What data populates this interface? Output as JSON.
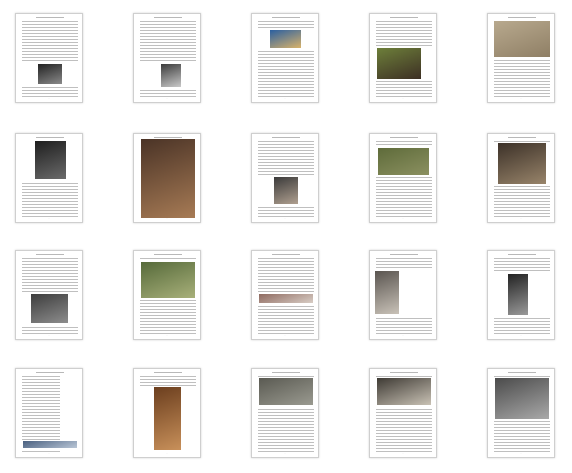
{
  "thumbnails": [
    {
      "photo": {
        "top": 0.55,
        "h": 0.22,
        "w": 0.35,
        "lp": 0.33,
        "colors": [
          "#222",
          "#8a8a8a"
        ]
      }
    },
    {
      "photo": {
        "top": 0.56,
        "h": 0.25,
        "w": 0.3,
        "lp": 0.4,
        "colors": [
          "#3b3b3b",
          "#c9c9c9"
        ]
      }
    },
    {
      "photo": {
        "top": 0.18,
        "h": 0.2,
        "w": 0.45,
        "lp": 0.27,
        "colors": [
          "#2a5fa0",
          "#d9b36a"
        ]
      }
    },
    {
      "photo": {
        "top": 0.38,
        "h": 0.34,
        "w": 0.65,
        "lp": 0.1,
        "colors": [
          "#6d7f3a",
          "#3d2f24"
        ]
      }
    },
    {
      "photo": {
        "top": 0.08,
        "h": 0.4,
        "w": 0.82,
        "lp": 0.09,
        "colors": [
          "#b8a98e",
          "#8f7f65"
        ]
      }
    },
    {
      "photo": {
        "top": 0.08,
        "h": 0.42,
        "w": 0.45,
        "lp": 0.28,
        "colors": [
          "#1e1e1e",
          "#6a6a6a"
        ]
      }
    },
    {
      "photo": {
        "top": 0.05,
        "h": 0.88,
        "w": 0.8,
        "lp": 0.1,
        "colors": [
          "#4a3326",
          "#a77b55"
        ]
      }
    },
    {
      "photo": {
        "top": 0.48,
        "h": 0.3,
        "w": 0.35,
        "lp": 0.33,
        "colors": [
          "#3a3a3a",
          "#b0a090"
        ]
      }
    },
    {
      "photo": {
        "top": 0.15,
        "h": 0.3,
        "w": 0.75,
        "lp": 0.12,
        "colors": [
          "#5e6b3a",
          "#8b9060"
        ]
      }
    },
    {
      "photo": {
        "top": 0.1,
        "h": 0.45,
        "w": 0.7,
        "lp": 0.15,
        "colors": [
          "#3c3128",
          "#98846a"
        ]
      }
    },
    {
      "photo": {
        "top": 0.48,
        "h": 0.32,
        "w": 0.55,
        "lp": 0.22,
        "colors": [
          "#3d3d3d",
          "#8d8d8d"
        ]
      }
    },
    {
      "photo": {
        "top": 0.12,
        "h": 0.4,
        "w": 0.8,
        "lp": 0.1,
        "colors": [
          "#566a3a",
          "#a8b07a"
        ]
      }
    },
    {
      "photo": {
        "top": 0.48,
        "h": 0.1,
        "w": 0.8,
        "lp": 0.1,
        "colors": [
          "#8f6a60",
          "#d8cdc5"
        ]
      }
    },
    {
      "photo": {
        "top": 0.22,
        "h": 0.48,
        "w": 0.35,
        "lp": 0.08,
        "colors": [
          "#5a5550",
          "#c9c2b8"
        ]
      }
    },
    {
      "photo": {
        "top": 0.25,
        "h": 0.45,
        "w": 0.3,
        "lp": 0.3,
        "colors": [
          "#222",
          "#9a9a9a"
        ]
      }
    },
    {
      "photo": {
        "top": 0.8,
        "h": 0.08,
        "w": 0.8,
        "lp": 0.1,
        "colors": [
          "#4a6080",
          "#b9c6d6"
        ]
      }
    },
    {
      "photo": {
        "top": 0.2,
        "h": 0.7,
        "w": 0.4,
        "lp": 0.3,
        "colors": [
          "#6b3e1e",
          "#c8905a"
        ]
      }
    },
    {
      "photo": {
        "top": 0.1,
        "h": 0.3,
        "w": 0.8,
        "lp": 0.1,
        "colors": [
          "#5a5a52",
          "#9a9a90"
        ]
      }
    },
    {
      "photo": {
        "top": 0.1,
        "h": 0.3,
        "w": 0.8,
        "lp": 0.1,
        "colors": [
          "#3e3a34",
          "#c9c2b5"
        ]
      }
    },
    {
      "photo": {
        "top": 0.1,
        "h": 0.45,
        "w": 0.8,
        "lp": 0.1,
        "colors": [
          "#4b4b4b",
          "#a9a9a9"
        ]
      }
    }
  ]
}
